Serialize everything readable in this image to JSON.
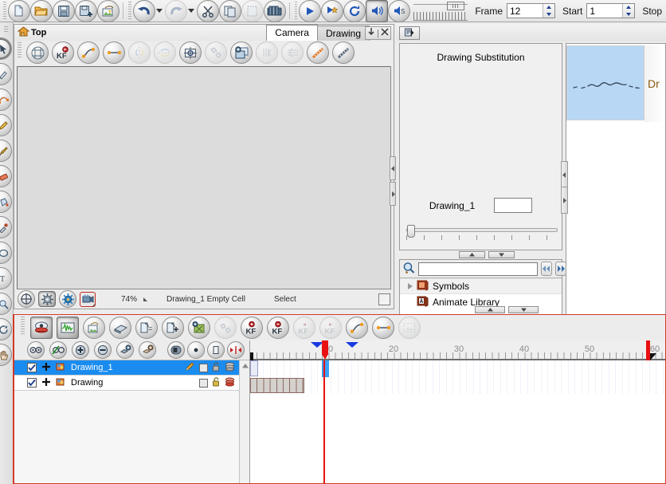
{
  "top_toolbar": {
    "buttons": [
      {
        "name": "new-scene-button",
        "icon": "new-document-icon"
      },
      {
        "name": "open-scene-button",
        "icon": "open-folder-icon"
      },
      {
        "name": "save-button",
        "icon": "save-disk-icon"
      },
      {
        "name": "save-all-button",
        "icon": "save-all-disk-icon"
      },
      {
        "name": "save-as-image-button",
        "icon": "export-image-icon"
      },
      {
        "name": "undo-button",
        "icon": "undo-arrow-icon"
      },
      {
        "name": "redo-button",
        "icon": "redo-arrow-icon"
      },
      {
        "name": "cut-button",
        "icon": "scissors-icon"
      },
      {
        "name": "copy-button",
        "icon": "copy-pages-icon"
      },
      {
        "name": "paste-button",
        "icon": "paste-clipboard-icon"
      },
      {
        "name": "library-button",
        "icon": "library-books-icon"
      },
      {
        "name": "play-button",
        "icon": "play-triangle-icon"
      },
      {
        "name": "play-preview-button",
        "icon": "play-star-icon"
      },
      {
        "name": "loop-button",
        "icon": "loop-circular-arrow-icon"
      },
      {
        "name": "sound-button",
        "icon": "speaker-on-icon"
      },
      {
        "name": "sound-scrub-button",
        "icon": "speaker-scrub-icon"
      }
    ],
    "frame_label": "Frame",
    "frame_value": "12",
    "start_label": "Start",
    "start_value": "1",
    "stop_label": "Stop"
  },
  "left_tools": [
    {
      "name": "tool-select",
      "icon": "arrow-pointer-icon",
      "selected": true
    },
    {
      "name": "tool-cutter",
      "icon": "cutter-knife-icon",
      "selected": false
    },
    {
      "name": "tool-contour-editor",
      "icon": "contour-editor-icon",
      "selected": false
    },
    {
      "name": "tool-pencil",
      "icon": "pencil-icon",
      "selected": false
    },
    {
      "name": "tool-brush",
      "icon": "brush-icon",
      "selected": false
    },
    {
      "name": "tool-eraser",
      "icon": "eraser-icon",
      "selected": false
    },
    {
      "name": "tool-paint",
      "icon": "paint-bucket-icon",
      "selected": false
    },
    {
      "name": "tool-dropper",
      "icon": "eyedropper-icon",
      "selected": false
    },
    {
      "name": "tool-ellipse",
      "icon": "ellipse-shape-icon",
      "selected": false
    },
    {
      "name": "tool-text",
      "icon": "text-tool-icon",
      "selected": false
    },
    {
      "name": "tool-zoom",
      "icon": "magnifier-icon",
      "selected": false
    },
    {
      "name": "tool-rotate",
      "icon": "rotate-view-icon",
      "selected": false
    },
    {
      "name": "tool-hand",
      "icon": "hand-pan-icon",
      "selected": false
    }
  ],
  "camera_panel": {
    "title": "Top",
    "tabs": [
      {
        "label": "Camera",
        "active": true
      },
      {
        "label": "Drawing",
        "active": false
      }
    ],
    "tab_buttons": [
      {
        "name": "collapse-view-button",
        "icon": "down-arrow-icon"
      },
      {
        "name": "close-view-button",
        "icon": "close-x-icon"
      }
    ],
    "toolbar": [
      {
        "name": "grid-button",
        "icon": "grid-icon",
        "enabled": true
      },
      {
        "name": "add-keyframe-button",
        "icon": "kf-add-icon",
        "enabled": true
      },
      {
        "name": "animate-path-button",
        "icon": "motion-path-icon",
        "enabled": true
      },
      {
        "name": "straight-path-button",
        "icon": "straight-path-icon",
        "enabled": true
      },
      {
        "name": "flip-horizontal-button",
        "icon": "flip-horizontal-icon",
        "enabled": false
      },
      {
        "name": "flip-vertical-button",
        "icon": "flip-vertical-icon",
        "enabled": false
      },
      {
        "name": "reposition-all-drawings-button",
        "icon": "reposition-target-icon",
        "enabled": true
      },
      {
        "name": "morph-button",
        "icon": "morph-icon",
        "enabled": false
      },
      {
        "name": "add-layer-button",
        "icon": "add-layer-icon",
        "enabled": true
      },
      {
        "name": "onion-skin-prev-button",
        "icon": "onion-prev-icon",
        "enabled": false
      },
      {
        "name": "onion-skin-button",
        "icon": "onion-skin-icon",
        "enabled": false
      },
      {
        "name": "light-table-button",
        "icon": "ruler-diagonal-icon",
        "enabled": true
      },
      {
        "name": "measure-button",
        "icon": "measure-icon",
        "enabled": true
      }
    ],
    "status": {
      "zoom": "74%",
      "cell_info": "Drawing_1 Empty Cell",
      "tool_mode": "Select",
      "buttons": [
        {
          "name": "camera-center-button",
          "icon": "crosshair-circle-icon"
        },
        {
          "name": "render-preview-button",
          "icon": "gear-gray-icon"
        },
        {
          "name": "opengl-preview-button",
          "icon": "gear-blue-icon"
        },
        {
          "name": "camera-mask-button",
          "icon": "camera-mask-icon"
        }
      ]
    }
  },
  "drawing_substitution": {
    "tab_button": {
      "name": "panel-menu-button",
      "icon": "panel-menu-icon"
    },
    "title": "Drawing Substitution",
    "current_drawing": "Drawing_1",
    "field_value": "",
    "nav_up": {
      "name": "substitute-prev-button",
      "icon": "small-up-arrow-icon"
    },
    "nav_down": {
      "name": "substitute-next-button",
      "icon": "small-down-arrow-icon"
    }
  },
  "library": {
    "search_placeholder": "",
    "search_value": "",
    "back_button": {
      "name": "library-back-button",
      "icon": "double-left-arrow-icon"
    },
    "forward_button": {
      "name": "library-forward-button",
      "icon": "double-right-arrow-icon"
    },
    "search_icon": "magnifier-search-icon",
    "items": [
      {
        "label": "Symbols",
        "icon": "symbols-folder-icon",
        "expandable": true,
        "highlighted": true
      },
      {
        "label": "Animate Library",
        "icon": "animate-library-icon",
        "expandable": false,
        "highlighted": false
      }
    ],
    "preview": {
      "thumbnail_label": "Dr",
      "thumbnail_bg": "#b7d7f5"
    }
  },
  "timeline": {
    "toolbar": [
      {
        "name": "show-hide-onion-button",
        "icon": "onion-eye-icon",
        "enabled": true,
        "pressed": true
      },
      {
        "name": "show-function-editor-button",
        "icon": "waveform-icon",
        "enabled": true,
        "pressed": true
      },
      {
        "name": "add-drawing-layer-button",
        "icon": "add-drawing-layer-icon",
        "enabled": true
      },
      {
        "name": "add-peg-button",
        "icon": "add-peg-icon",
        "enabled": true
      },
      {
        "name": "duplicate-drawing-button",
        "icon": "duplicate-drawing-icon",
        "enabled": true
      },
      {
        "name": "add-drawing-button",
        "icon": "add-drawing-plus-icon",
        "enabled": true
      },
      {
        "name": "delete-drawing-button",
        "icon": "delete-drawing-icon",
        "enabled": true
      },
      {
        "name": "morph-timeline-button",
        "icon": "morph-dots-icon",
        "enabled": false
      },
      {
        "name": "add-keyframe-button",
        "icon": "kf-add-red-icon",
        "enabled": true
      },
      {
        "name": "remove-keyframe-button",
        "icon": "kf-remove-red-icon",
        "enabled": true
      },
      {
        "name": "prev-keyframe-button",
        "icon": "kf-prev-icon",
        "enabled": false
      },
      {
        "name": "next-keyframe-button",
        "icon": "kf-next-icon",
        "enabled": false
      },
      {
        "name": "set-ease-button",
        "icon": "motion-path-icon",
        "enabled": true
      },
      {
        "name": "constant-segment-button",
        "icon": "straight-path-icon",
        "enabled": true
      },
      {
        "name": "toggle-thumbnails-button",
        "icon": "thumbnails-icon",
        "enabled": false
      }
    ],
    "layer_tools": [
      {
        "name": "show-all-layers-button",
        "icon": "glasses-icon"
      },
      {
        "name": "hide-selection-button",
        "icon": "glasses-off-icon"
      },
      {
        "name": "add-layer-button",
        "icon": "plus-circle-icon"
      },
      {
        "name": "delete-layer-button",
        "icon": "minus-circle-icon"
      },
      {
        "name": "add-group-button",
        "icon": "group-add-icon"
      },
      {
        "name": "add-peg-layer-button",
        "icon": "peg-add-icon"
      }
    ],
    "layer_tools_right": [
      {
        "name": "show-thumbnails-button",
        "icon": "thumb-left-icon"
      },
      {
        "name": "show-dot-button",
        "icon": "dot-center-icon"
      },
      {
        "name": "show-panel-button",
        "icon": "panel-icon"
      },
      {
        "name": "expand-columns-button",
        "icon": "expand-horizontal-icon"
      }
    ],
    "layers": [
      {
        "name": "Drawing_1",
        "checked": true,
        "selected": true,
        "icons": [
          "pencil-icon",
          "color-square-icon",
          "lock-open-icon",
          "onion-stack-icon"
        ]
      },
      {
        "name": "Drawing",
        "checked": true,
        "selected": false,
        "icons": [
          "color-square-icon",
          "lock-open-icon",
          "onion-stack-red-icon"
        ]
      }
    ],
    "ruler": {
      "labels": [
        "10",
        "20",
        "30",
        "40",
        "50",
        "60"
      ],
      "label_frames": [
        10,
        20,
        30,
        40,
        50,
        60
      ],
      "frame_width": 8.2,
      "first_frame": 1
    },
    "playhead_frame": 12,
    "range_start_frame": 9,
    "range_end_frame": 15,
    "scene_end_frame": 60,
    "exposures": [
      {
        "layer": "Drawing_1",
        "start": 12,
        "end": 12,
        "color": "#3aa0f5"
      },
      {
        "layer": "Drawing",
        "start": 1,
        "end": 9,
        "color": "#d5d1cd"
      }
    ]
  },
  "colors": {
    "accent_selected": "#1a8cf0",
    "playhead_red": "#e81010",
    "panel_border_red": "#d23a2a",
    "thumbnail_blue": "#b7d7f5",
    "canvas_gray": "#dcdcdc"
  }
}
